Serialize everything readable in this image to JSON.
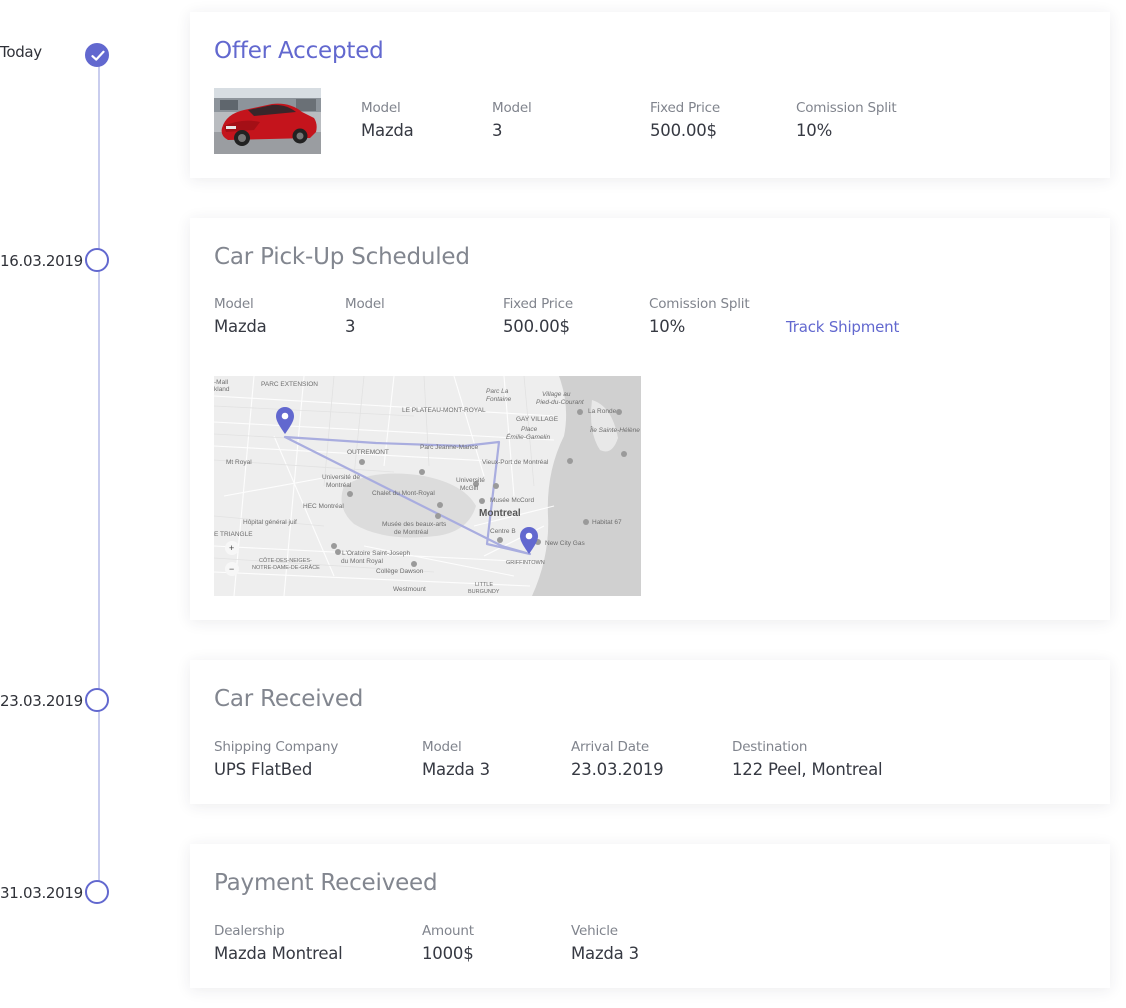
{
  "timeline": [
    {
      "date": "Today",
      "state": "done"
    },
    {
      "date": "16.03.2019",
      "state": "pending"
    },
    {
      "date": "23.03.2019",
      "state": "pending"
    },
    {
      "date": "31.03.2019",
      "state": "pending"
    }
  ],
  "cards": {
    "offer": {
      "title": "Offer Accepted",
      "fields": [
        {
          "label": "Model",
          "value": "Mazda"
        },
        {
          "label": "Model",
          "value": "3"
        },
        {
          "label": "Fixed Price",
          "value": "500.00$"
        },
        {
          "label": "Comission Split",
          "value": "10%"
        }
      ]
    },
    "pickup": {
      "title": "Car Pick-Up Scheduled",
      "fields": [
        {
          "label": "Model",
          "value": "Mazda"
        },
        {
          "label": "Model",
          "value": "3"
        },
        {
          "label": "Fixed Price",
          "value": "500.00$"
        },
        {
          "label": "Comission Split",
          "value": "10%"
        }
      ],
      "link_label": "Track Shipment",
      "map": {
        "labels": {
          "parc_extension": "PARC EXTENSION",
          "mall": "-Mall",
          "kland": "kland",
          "plateau": "LE PLATEAU-MONT-ROYAL",
          "parc_la_fontaine": "Parc La",
          "fontaine": "Fontaine",
          "village_au": "Village au",
          "pied_du_courant": "Pied-du-Courant",
          "gay_village": "GAY VILLAGE",
          "place": "Place",
          "emilie_gamelin": "Émilie-Gamelin",
          "la_ronde": "La Ronde",
          "ile_sainte_helene": "Île Sainte-Hélène",
          "outremont": "OUTREMONT",
          "parc_jeanne_mance": "Parc Jeanne-Mance",
          "vieux_port": "Vieux-Port de Montréal",
          "mt_royal": "Mt Royal",
          "universite_de": "Université de",
          "montreal_lower": "Montréal",
          "universite": "Université",
          "mcgill": "McGill",
          "chalet": "Chalet du Mont-Royal",
          "musee_mccord": "Musée McCord",
          "hec": "HEC Montréal",
          "montreal": "Montreal",
          "hopital": "Hôpital général juif",
          "musee_beaux_arts": "Musée des beaux-arts",
          "de_montreal": "de Montréal",
          "centre_b": "Centre B",
          "habitat": "Habitat 67",
          "triangle": "E TRIANGLE",
          "new_city_gas": "New City Gas",
          "oratoire": "L'Oratoire Saint-Joseph",
          "du_mont_royal": "du Mont Royal",
          "cote_des_neiges": "CÔTE-DES-NEIGES-",
          "notre_dame": "NOTRE-DAME-DE-GRÂCE",
          "griffintown": "GRIFFINTOWN",
          "college_dawson": "Collège Dawson",
          "westmount": "Westmount",
          "little": "LITTLE",
          "burgundy": "BURGUNDY"
        },
        "zoom_in": "+",
        "zoom_out": "−"
      }
    },
    "received": {
      "title": "Car Received",
      "fields": [
        {
          "label": "Shipping Company",
          "value": "UPS FlatBed"
        },
        {
          "label": "Model",
          "value": "Mazda 3"
        },
        {
          "label": "Arrival Date",
          "value": "23.03.2019"
        },
        {
          "label": "Destination",
          "value": "122 Peel, Montreal"
        }
      ]
    },
    "payment": {
      "title": "Payment Receiveed",
      "fields": [
        {
          "label": "Dealership",
          "value": "Mazda Montreal"
        },
        {
          "label": "Amount",
          "value": "1000$"
        },
        {
          "label": "Vehicle",
          "value": "Mazda 3"
        }
      ]
    }
  },
  "colors": {
    "accent": "#6268cf",
    "line": "#c9cdee",
    "title_muted": "#82868f",
    "label": "#80848d",
    "value": "#363942"
  }
}
